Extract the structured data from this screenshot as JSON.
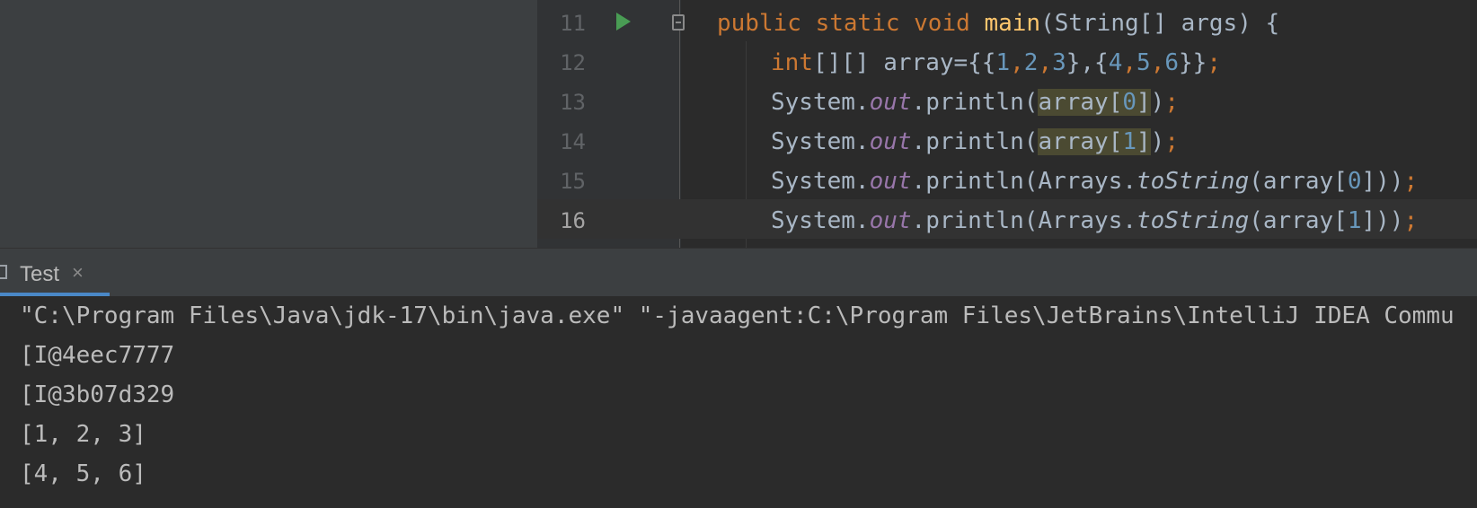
{
  "editor": {
    "lines": [
      {
        "num": "11",
        "tokens": [
          [
            "kw",
            "public "
          ],
          [
            "kw",
            "static "
          ],
          [
            "kw",
            "void "
          ],
          [
            "fn",
            "main"
          ],
          [
            "",
            "(String[] args) {"
          ]
        ]
      },
      {
        "num": "12",
        "tokens": [
          [
            "kw",
            "int"
          ],
          [
            "",
            "[][] array={{"
          ],
          [
            "num",
            "1"
          ],
          [
            "kw",
            ","
          ],
          [
            "num",
            "2"
          ],
          [
            "kw",
            ","
          ],
          [
            "num",
            "3"
          ],
          [
            "",
            "},{"
          ],
          [
            "num",
            "4"
          ],
          [
            "kw",
            ","
          ],
          [
            "num",
            "5"
          ],
          [
            "kw",
            ","
          ],
          [
            "num",
            "6"
          ],
          [
            "",
            "}}"
          ],
          [
            "kw",
            ";"
          ]
        ]
      },
      {
        "num": "13",
        "tokens": [
          [
            "",
            "System."
          ],
          [
            "field",
            "out"
          ],
          [
            "",
            ".println("
          ],
          [
            "hl",
            "array["
          ],
          [
            "hlnum",
            "0"
          ],
          [
            "hl",
            "]"
          ],
          [
            ")"
          ],
          [
            "kw",
            ";"
          ]
        ]
      },
      {
        "num": "14",
        "tokens": [
          [
            "",
            "System."
          ],
          [
            "field",
            "out"
          ],
          [
            "",
            ".println("
          ],
          [
            "hl",
            "array["
          ],
          [
            "hlnum",
            "1"
          ],
          [
            "hl",
            "]"
          ],
          [
            ")"
          ],
          [
            "kw",
            ";"
          ]
        ]
      },
      {
        "num": "15",
        "tokens": [
          [
            "",
            "System."
          ],
          [
            "field",
            "out"
          ],
          [
            "",
            ".println(Arrays."
          ],
          [
            "ital",
            "toString"
          ],
          [
            "",
            "(array["
          ],
          [
            "num",
            "0"
          ],
          [
            "",
            "]))"
          ],
          [
            "kw",
            ";"
          ]
        ]
      },
      {
        "num": "16",
        "tokens": [
          [
            "",
            "System."
          ],
          [
            "field",
            "out"
          ],
          [
            "",
            ".println(Arrays."
          ],
          [
            "ital",
            "toString"
          ],
          [
            "",
            "(array["
          ],
          [
            "num",
            "1"
          ],
          [
            "",
            "]))"
          ],
          [
            "kw",
            ";"
          ]
        ]
      }
    ]
  },
  "run_tab": {
    "label": "Test",
    "close": "×"
  },
  "console": {
    "lines": [
      "\"C:\\Program Files\\Java\\jdk-17\\bin\\java.exe\" \"-javaagent:C:\\Program Files\\JetBrains\\IntelliJ IDEA Commu",
      "[I@4eec7777",
      "[I@3b07d329",
      "[1, 2, 3]",
      "[4, 5, 6]"
    ]
  },
  "colors": {
    "keyword": "#cc7832",
    "function": "#ffc66d",
    "number": "#6897bb",
    "field": "#9876aa",
    "text": "#a9b7c6",
    "tab_accent": "#4a88c7"
  }
}
